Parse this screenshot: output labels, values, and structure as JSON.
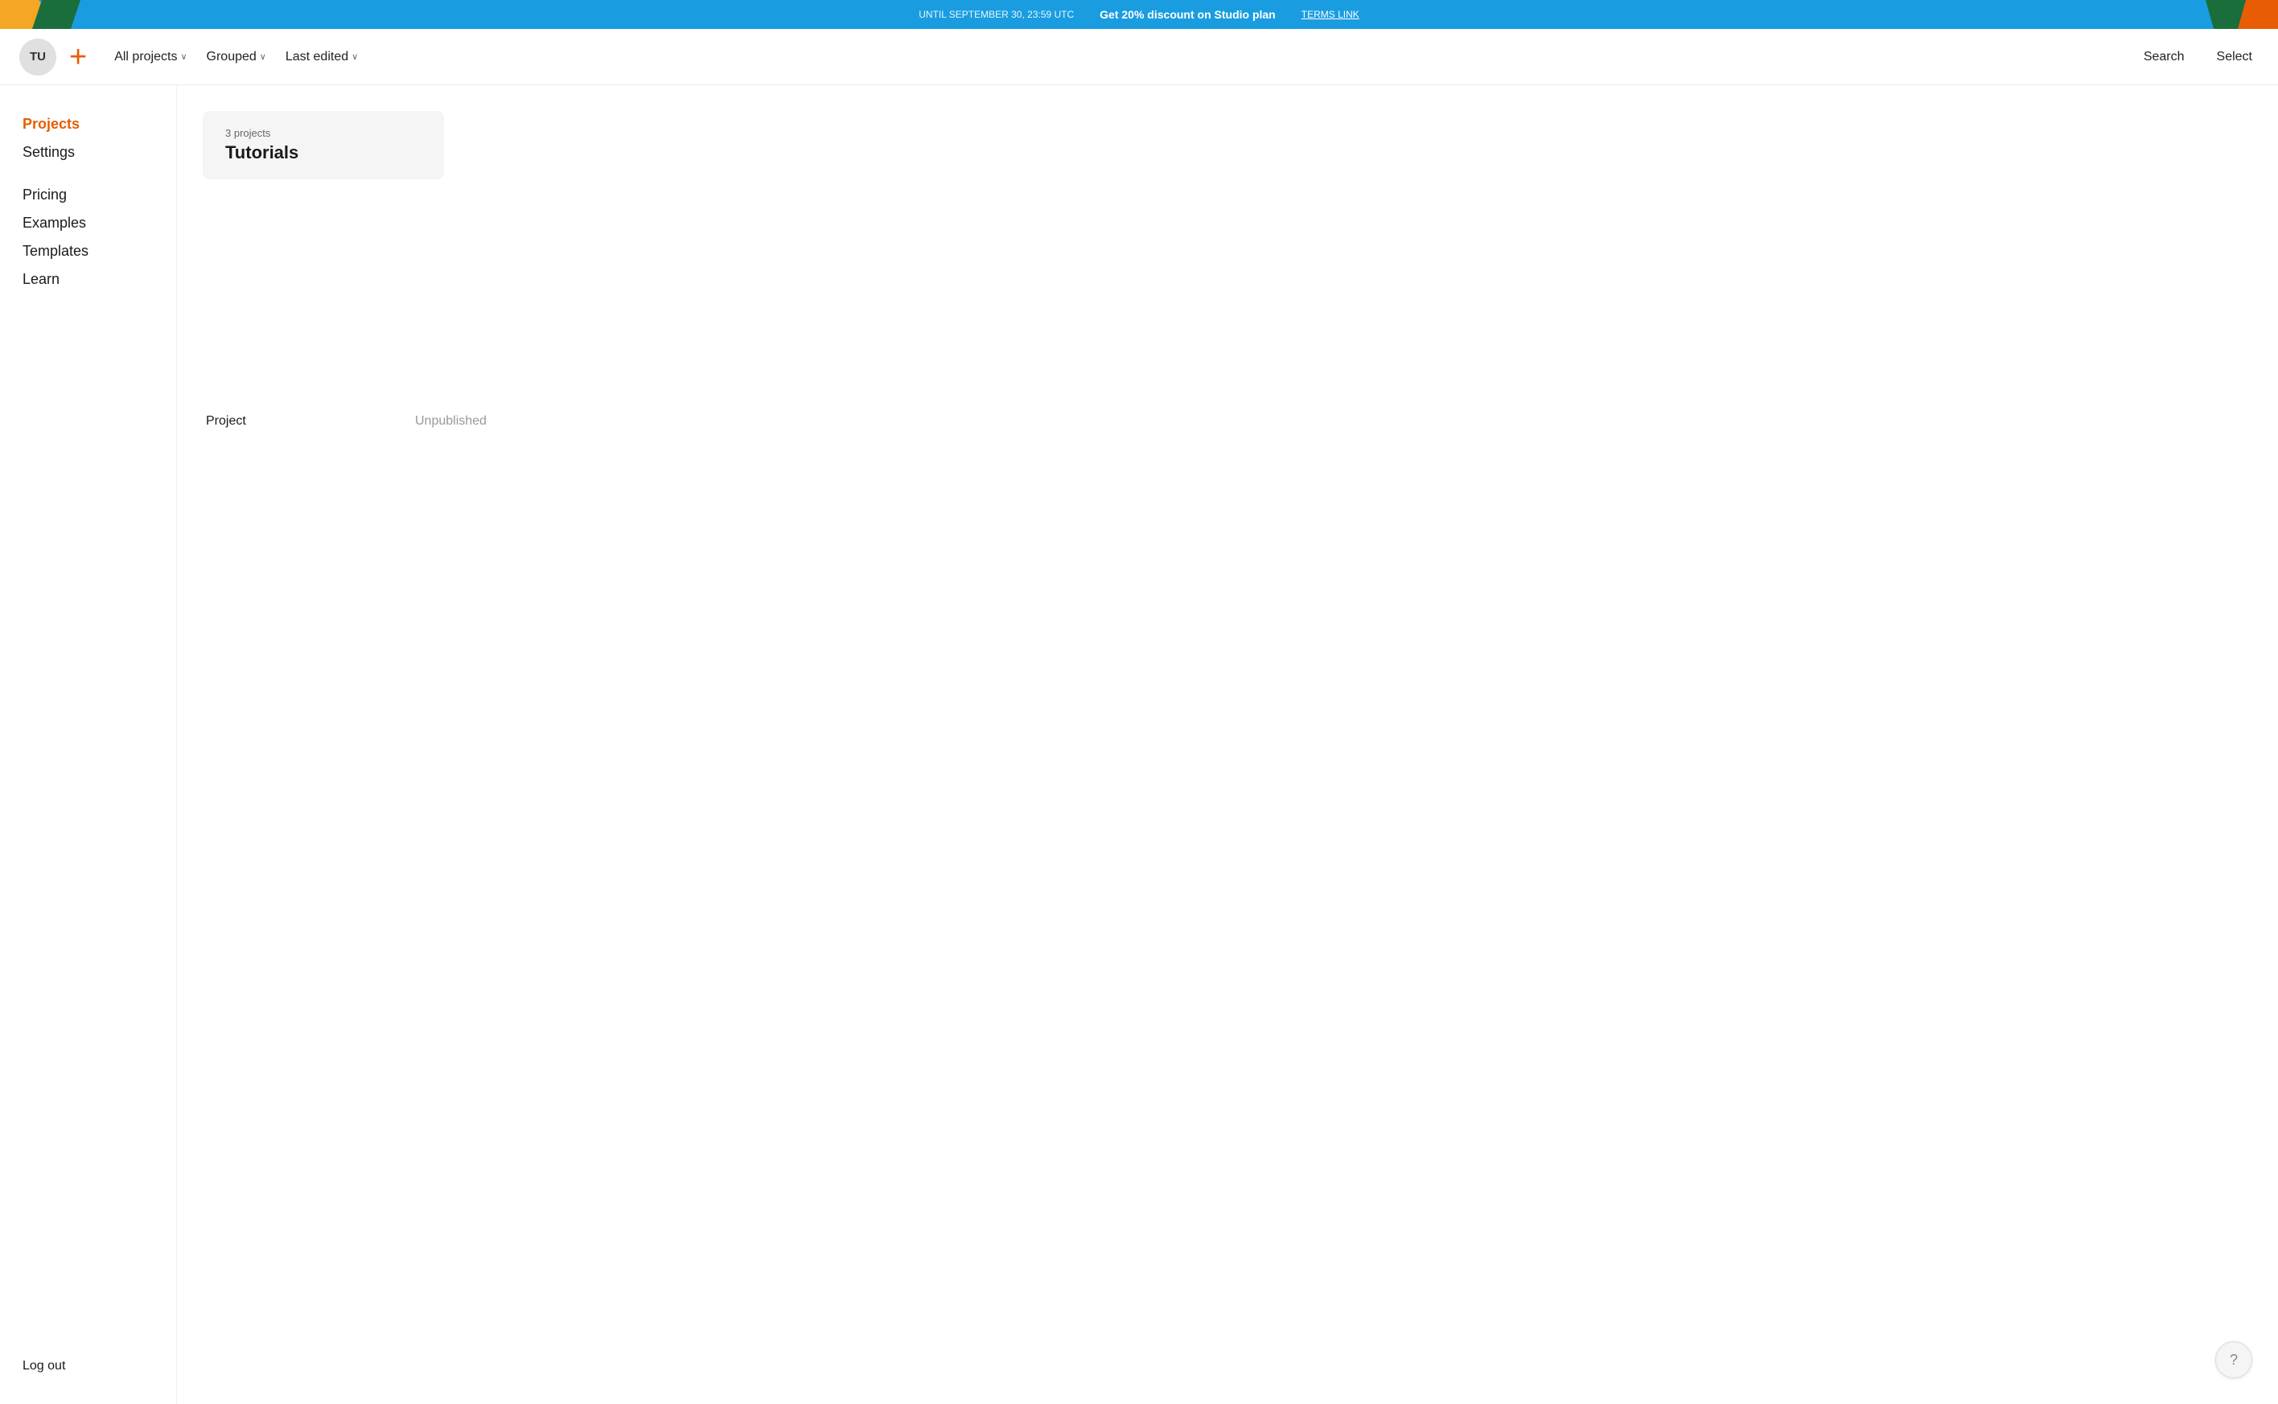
{
  "banner": {
    "until_text": "UNTIL SEPTEMBER 30, 23:59 UTC",
    "cta_text": "Get 20% discount on Studio plan",
    "terms_text": "TERMS LINK"
  },
  "header": {
    "avatar_initials": "TU",
    "new_project_icon": "+",
    "nav": [
      {
        "label": "All projects",
        "has_dropdown": true
      },
      {
        "label": "Grouped",
        "has_dropdown": true
      },
      {
        "label": "Last edited",
        "has_dropdown": true
      }
    ],
    "search_label": "Search",
    "select_label": "Select"
  },
  "sidebar": {
    "items": [
      {
        "label": "Projects",
        "active": true
      },
      {
        "label": "Settings",
        "active": false
      }
    ],
    "secondary_items": [
      {
        "label": "Pricing"
      },
      {
        "label": "Examples"
      },
      {
        "label": "Templates"
      },
      {
        "label": "Learn"
      }
    ],
    "logout_label": "Log out"
  },
  "group": {
    "count_label": "3 projects",
    "title": "Tutorials"
  },
  "project_row": {
    "name": "Project",
    "status": "Unpublished"
  },
  "help": {
    "icon": "?"
  }
}
